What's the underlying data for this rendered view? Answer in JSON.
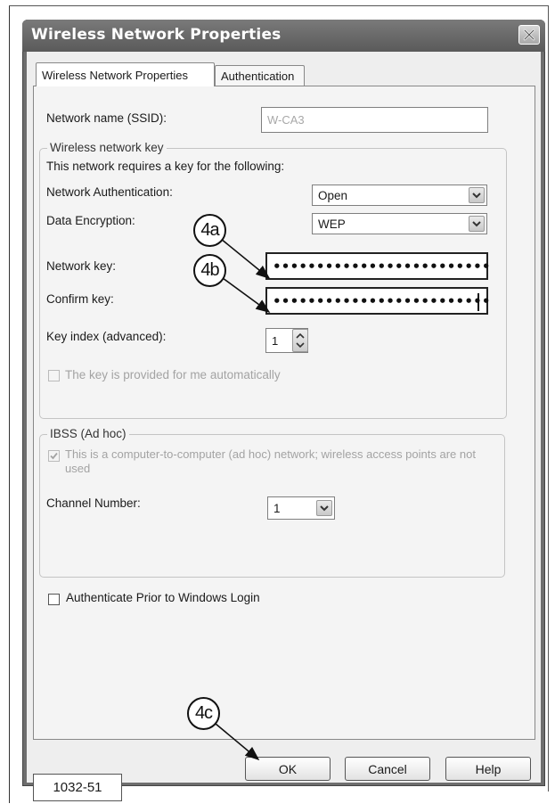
{
  "dialog": {
    "title": "Wireless Network Properties",
    "tabs": [
      {
        "label": "Wireless Network Properties",
        "active": true
      },
      {
        "label": "Authentication",
        "active": false
      }
    ]
  },
  "ssid": {
    "label": "Network name (SSID):",
    "value": "W-CA3"
  },
  "wireless_key": {
    "group_label": "Wireless network key",
    "requirement_text": "This network requires a key for the following:",
    "auth_label": "Network Authentication:",
    "auth_value": "Open",
    "encryption_label": "Data Encryption:",
    "encryption_value": "WEP",
    "network_key_label": "Network key:",
    "network_key_value": "•••••••••••••••••••••••••",
    "confirm_key_label": "Confirm key:",
    "confirm_key_value": "•••••••••••••••••••••••••",
    "key_index_label": "Key index (advanced):",
    "key_index_value": "1",
    "auto_key_label": "The key is provided for me automatically",
    "auto_key_checked": false
  },
  "ibss": {
    "group_label": "IBSS (Ad hoc)",
    "adhoc_label": "This is a computer-to-computer (ad hoc) network; wireless access points are not used",
    "adhoc_checked": true,
    "channel_label": "Channel Number:",
    "channel_value": "1"
  },
  "authenticate_prior": {
    "label": "Authenticate Prior to Windows Login",
    "checked": false
  },
  "buttons": {
    "ok": "OK",
    "cancel": "Cancel",
    "help": "Help"
  },
  "callouts": {
    "a": "4a",
    "b": "4b",
    "c": "4c"
  },
  "figure_label": "1032-51"
}
